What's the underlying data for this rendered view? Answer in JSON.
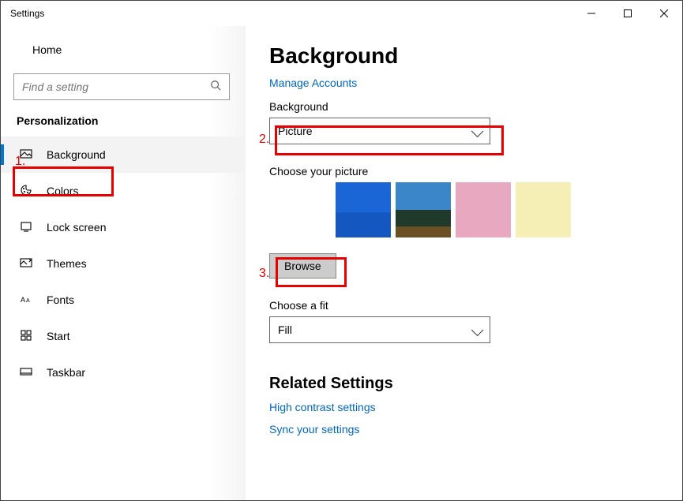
{
  "window": {
    "title": "Settings"
  },
  "sidebar": {
    "home": "Home",
    "search_placeholder": "Find a setting",
    "section": "Personalization",
    "items": [
      {
        "label": "Background"
      },
      {
        "label": "Colors"
      },
      {
        "label": "Lock screen"
      },
      {
        "label": "Themes"
      },
      {
        "label": "Fonts"
      },
      {
        "label": "Start"
      },
      {
        "label": "Taskbar"
      }
    ]
  },
  "main": {
    "title": "Background",
    "manage_link": "Manage Accounts",
    "bg_label": "Background",
    "bg_value": "Picture",
    "choose_label": "Choose your picture",
    "browse": "Browse",
    "fit_label": "Choose a fit",
    "fit_value": "Fill",
    "related_title": "Related Settings",
    "link1": "High contrast settings",
    "link2": "Sync your settings"
  },
  "annotations": {
    "one": "1.",
    "two": "2.",
    "three": "3."
  }
}
